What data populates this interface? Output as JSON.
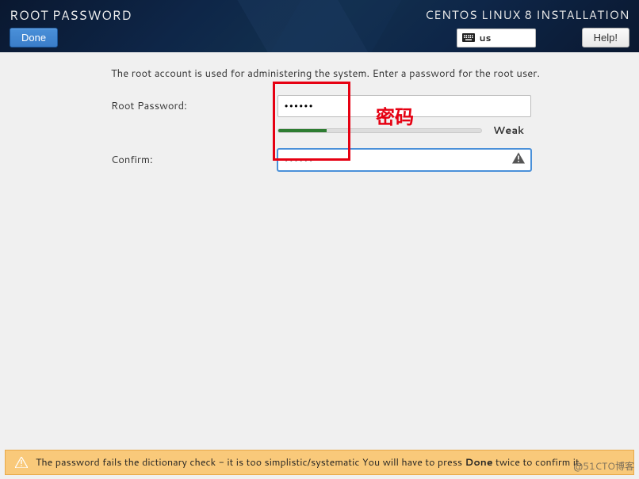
{
  "header": {
    "page_title": "ROOT PASSWORD",
    "done_label": "Done",
    "install_title": "CENTOS LINUX 8 INSTALLATION",
    "language_code": "us",
    "help_label": "Help!"
  },
  "form": {
    "instruction": "The root account is used for administering the system.  Enter a password for the root user.",
    "root_password_label": "Root Password:",
    "root_password_value": "••••••",
    "strength_label": "Weak",
    "strength_percent": 24,
    "confirm_label": "Confirm:",
    "confirm_value": "••••••"
  },
  "annotation": {
    "text": "密码"
  },
  "warning": {
    "text_prefix": "The password fails the dictionary check - it is too simplistic/systematic You will have to press ",
    "bold": "Done",
    "text_suffix": " twice to confirm it."
  },
  "watermark": "@51CTO博客"
}
